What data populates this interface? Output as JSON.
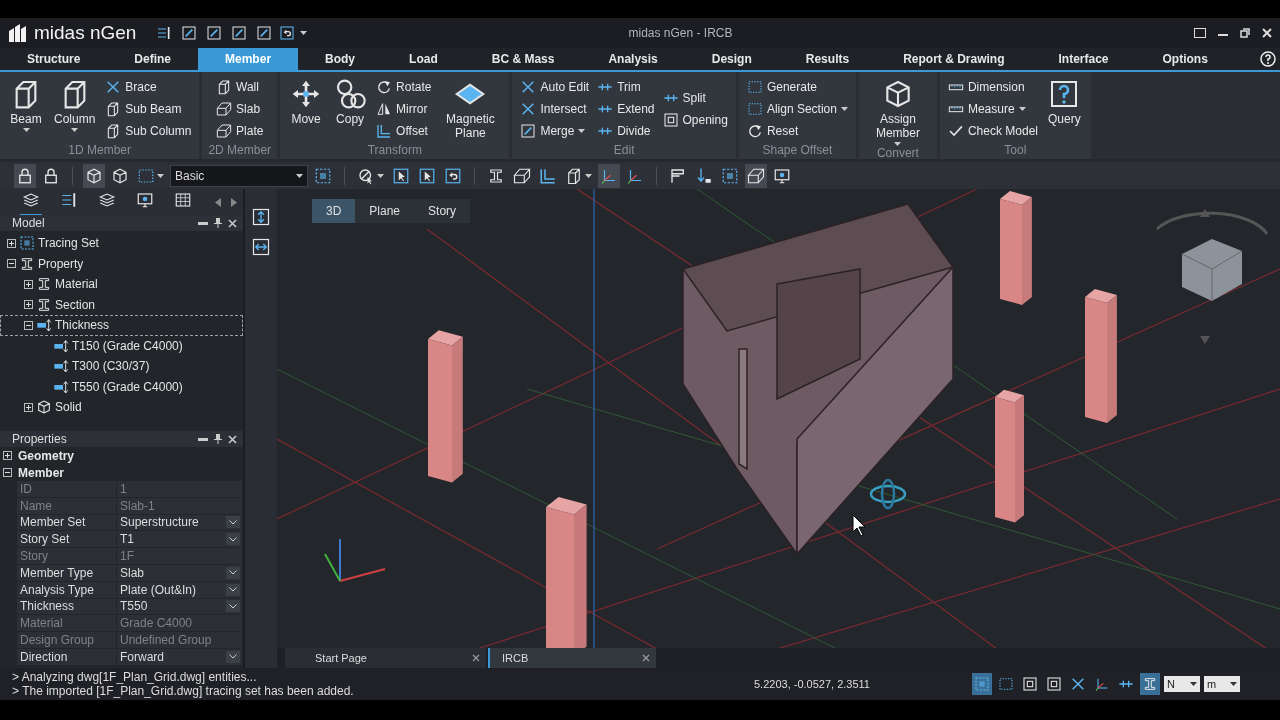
{
  "app": {
    "logo": "midas nGen",
    "title": "midas nGen - IRCB"
  },
  "menu_tabs": [
    {
      "label": "Structure",
      "selected": false
    },
    {
      "label": "Define",
      "selected": false
    },
    {
      "label": "Member",
      "selected": true
    },
    {
      "label": "Body",
      "selected": false
    },
    {
      "label": "Load",
      "selected": false
    },
    {
      "label": "BC & Mass",
      "selected": false
    },
    {
      "label": "Analysis",
      "selected": false
    },
    {
      "label": "Design",
      "selected": false
    },
    {
      "label": "Results",
      "selected": false
    },
    {
      "label": "Report & Drawing",
      "selected": false
    },
    {
      "label": "Interface",
      "selected": false
    },
    {
      "label": "Options",
      "selected": false
    }
  ],
  "ribbon": [
    {
      "label": "1D Member",
      "items": [
        {
          "label": "Beam",
          "kind": "large",
          "dropdown": true
        },
        {
          "label": "Column",
          "kind": "large",
          "dropdown": true
        },
        {
          "label": "Brace",
          "kind": "small"
        },
        {
          "label": "Sub Beam",
          "kind": "small"
        },
        {
          "label": "Sub Column",
          "kind": "small"
        }
      ]
    },
    {
      "label": "2D Member",
      "items": [
        {
          "label": "Wall",
          "kind": "small"
        },
        {
          "label": "Slab",
          "kind": "small"
        },
        {
          "label": "Plate",
          "kind": "small"
        }
      ]
    },
    {
      "label": "Transform",
      "items": [
        {
          "label": "Move",
          "kind": "large"
        },
        {
          "label": "Copy",
          "kind": "large"
        },
        {
          "label": "Rotate",
          "kind": "small"
        },
        {
          "label": "Mirror",
          "kind": "small"
        },
        {
          "label": "Offset",
          "kind": "small"
        },
        {
          "label": "Magnetic Plane",
          "kind": "large"
        }
      ]
    },
    {
      "label": "Edit",
      "items": [
        {
          "label": "Auto Edit",
          "kind": "small"
        },
        {
          "label": "Intersect",
          "kind": "small"
        },
        {
          "label": "Merge",
          "kind": "small",
          "dropdown": true
        },
        {
          "label": "Trim",
          "kind": "small"
        },
        {
          "label": "Extend",
          "kind": "small"
        },
        {
          "label": "Divide",
          "kind": "small"
        },
        {
          "label": "Split",
          "kind": "small"
        },
        {
          "label": "Opening",
          "kind": "small"
        }
      ]
    },
    {
      "label": "Shape Offset",
      "items": [
        {
          "label": "Generate",
          "kind": "small"
        },
        {
          "label": "Align Section",
          "kind": "small",
          "dropdown": true
        },
        {
          "label": "Reset",
          "kind": "small"
        }
      ]
    },
    {
      "label": "Convert",
      "items": [
        {
          "label": "Assign Member",
          "kind": "large",
          "dropdown": true
        }
      ]
    },
    {
      "label": "Tool",
      "items": [
        {
          "label": "Dimension",
          "kind": "small"
        },
        {
          "label": "Measure",
          "kind": "small",
          "dropdown": true
        },
        {
          "label": "Check Model",
          "kind": "small"
        },
        {
          "label": "Query",
          "kind": "large"
        }
      ]
    }
  ],
  "toolbar": {
    "combo": "Basic",
    "buttons": [
      {
        "on": true
      },
      {
        "on": false
      },
      {
        "on": true
      },
      {
        "on": false
      },
      {
        "on": false
      },
      {
        "on": false
      },
      {
        "on": false
      },
      {
        "on": false
      },
      {
        "on": false
      },
      {
        "on": false
      },
      {
        "on": false
      },
      {
        "on": false
      },
      {
        "on": false
      },
      {
        "on": false
      },
      {
        "on": true
      },
      {
        "on": false
      },
      {
        "on": false
      },
      {
        "on": false
      },
      {
        "on": false
      },
      {
        "on": true
      },
      {
        "on": false
      }
    ]
  },
  "panel_tabs": [
    {
      "selected": true
    },
    {
      "selected": false
    },
    {
      "selected": false
    },
    {
      "selected": false
    },
    {
      "selected": false
    }
  ],
  "model_tree": {
    "title": "Model",
    "items": [
      {
        "label": "Tracing Set",
        "kind": "tracing",
        "expanded": false,
        "selected": false
      },
      {
        "label": "Property",
        "kind": "section",
        "expanded": true,
        "selected": false,
        "children": [
          {
            "label": "Material",
            "kind": "section",
            "expanded": false,
            "selected": false
          },
          {
            "label": "Section",
            "kind": "section",
            "expanded": false,
            "selected": false
          },
          {
            "label": "Thickness",
            "kind": "thickness",
            "expanded": true,
            "selected": true,
            "children": [
              {
                "label": "T150 (Grade C4000)",
                "kind": "thickness",
                "selected": false
              },
              {
                "label": "T300 (C30/37)",
                "kind": "thickness",
                "selected": false
              },
              {
                "label": "T550 (Grade C4000)",
                "kind": "thickness",
                "selected": false
              }
            ]
          },
          {
            "label": "Solid",
            "kind": "solid",
            "expanded": false,
            "selected": false
          }
        ]
      }
    ]
  },
  "properties": {
    "title": "Properties",
    "sections": [
      {
        "label": "Geometry",
        "expanded": false
      },
      {
        "label": "Member",
        "expanded": true,
        "rows": [
          {
            "name": "ID",
            "value": "1",
            "disabled": true
          },
          {
            "name": "Name",
            "value": "Slab-1",
            "disabled": true
          },
          {
            "name": "Member Set",
            "value": "Superstructure",
            "disabled": false,
            "dropdown": true
          },
          {
            "name": "Story Set",
            "value": "T1",
            "disabled": false,
            "dropdown": true
          },
          {
            "name": "Story",
            "value": "1F",
            "disabled": true
          },
          {
            "name": "Member Type",
            "value": "Slab",
            "disabled": false,
            "dropdown": true
          },
          {
            "name": "Analysis Type",
            "value": "Plate (Out&In)",
            "disabled": false,
            "dropdown": true
          },
          {
            "name": "Thickness",
            "value": "T550",
            "disabled": false,
            "dropdown": true
          },
          {
            "name": "Material",
            "value": "Grade C4000",
            "disabled": true
          },
          {
            "name": "Design Group",
            "value": "Undefined Group",
            "disabled": true
          },
          {
            "name": "Direction",
            "value": "Forward",
            "disabled": false,
            "dropdown": true
          }
        ]
      }
    ]
  },
  "view_tabs": [
    {
      "label": "3D",
      "selected": true
    },
    {
      "label": "Plane",
      "selected": false
    },
    {
      "label": "Story",
      "selected": false
    }
  ],
  "doc_tabs": [
    {
      "label": "Start Page",
      "selected": false
    },
    {
      "label": "IRCB",
      "selected": true
    }
  ],
  "output": [
    "> Analyzing dwg[1F_Plan_Grid.dwg] entities...",
    "> The imported [1F_Plan_Grid.dwg] tracing set has been added."
  ],
  "status": {
    "coordinates": "5.2203, -0.0527, 2.3511",
    "tools": [
      {
        "on": true
      },
      {
        "on": false
      },
      {
        "on": false
      },
      {
        "on": false
      },
      {
        "on": false
      },
      {
        "on": false
      },
      {
        "on": false
      },
      {
        "on": true
      }
    ],
    "force_unit": "N",
    "length_unit": "m"
  }
}
